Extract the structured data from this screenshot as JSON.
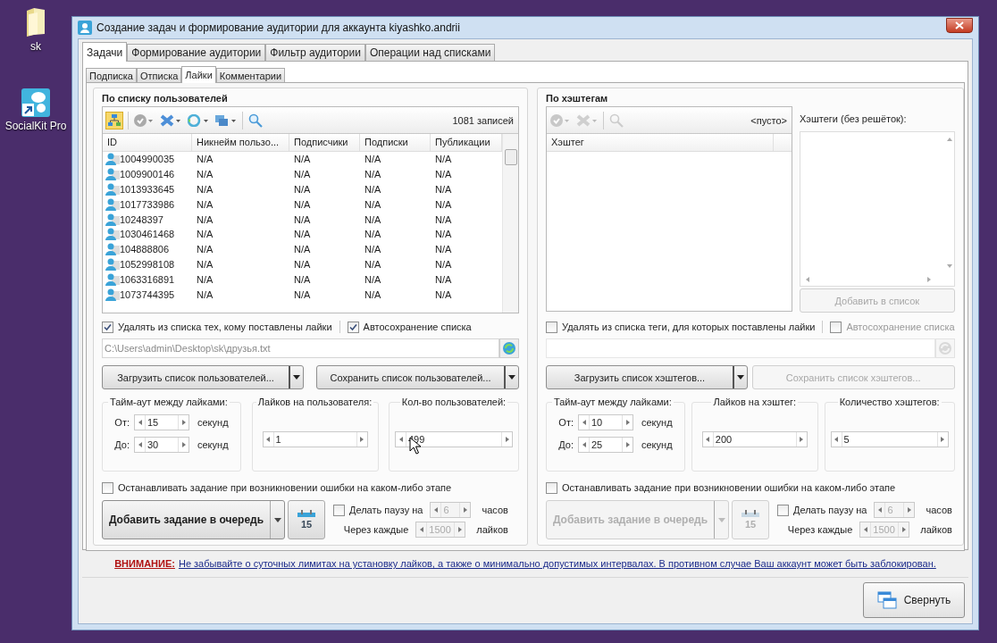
{
  "desktop_icons": [
    {
      "label": "sk",
      "kind": "folder"
    },
    {
      "label": "SocialKit Pro",
      "kind": "app"
    }
  ],
  "window": {
    "title": "Создание задач и формирование аудитории для аккаунта kiyashko.andrii"
  },
  "tabs": [
    {
      "label": "Задачи",
      "selected": true
    },
    {
      "label": "Формирование аудитории",
      "selected": false
    },
    {
      "label": "Фильтр аудитории",
      "selected": false
    },
    {
      "label": "Операции над списками",
      "selected": false
    }
  ],
  "subtabs": [
    {
      "label": "Подписка",
      "selected": false
    },
    {
      "label": "Отписка",
      "selected": false
    },
    {
      "label": "Лайки",
      "selected": true
    },
    {
      "label": "Комментарии",
      "selected": false
    }
  ],
  "users_panel": {
    "title": "По списку пользователей",
    "record_count": "1081 записей",
    "table": {
      "columns": [
        "ID",
        "Никнейм пользо...",
        "Подписчики",
        "Подписки",
        "Публикации"
      ],
      "rows": [
        [
          "1004990035",
          "N/A",
          "N/A",
          "N/A",
          "N/A"
        ],
        [
          "1009900146",
          "N/A",
          "N/A",
          "N/A",
          "N/A"
        ],
        [
          "1013933645",
          "N/A",
          "N/A",
          "N/A",
          "N/A"
        ],
        [
          "1017733986",
          "N/A",
          "N/A",
          "N/A",
          "N/A"
        ],
        [
          "10248397",
          "N/A",
          "N/A",
          "N/A",
          "N/A"
        ],
        [
          "1030461468",
          "N/A",
          "N/A",
          "N/A",
          "N/A"
        ],
        [
          "104888806",
          "N/A",
          "N/A",
          "N/A",
          "N/A"
        ],
        [
          "1052998108",
          "N/A",
          "N/A",
          "N/A",
          "N/A"
        ],
        [
          "1063316891",
          "N/A",
          "N/A",
          "N/A",
          "N/A"
        ],
        [
          "1073744395",
          "N/A",
          "N/A",
          "N/A",
          "N/A"
        ]
      ]
    },
    "remove_checkbox": {
      "label": "Удалять из списка тех, кому поставлены лайки",
      "checked": true
    },
    "autosave_checkbox": {
      "label": "Автосохранение списка",
      "checked": true,
      "disabled": false
    },
    "path_field": {
      "value": "C:\\Users\\admin\\Desktop\\sk\\друзья.txt",
      "disabled": false
    },
    "load_button": {
      "label": "Загрузить список пользователей...",
      "kind": "split",
      "disabled": false
    },
    "save_button": {
      "label": "Сохранить список пользователей...",
      "kind": "split",
      "disabled": false
    },
    "timeout": {
      "title": "Тайм-аут между лайками:",
      "from_label": "От:",
      "from": {
        "value": "15",
        "disabled": false
      },
      "from_unit": "секунд",
      "to_label": "До:",
      "to": {
        "value": "30",
        "disabled": false
      },
      "to_unit": "секунд"
    },
    "per_item": {
      "title": "Лайков на пользователя:",
      "field": {
        "value": "1",
        "disabled": false
      }
    },
    "count": {
      "title": "Кол-во пользователей:",
      "field": {
        "value": "499",
        "disabled": false
      }
    },
    "stop_checkbox": {
      "label": "Останавливать задание при возникновении ошибки на каком-либо этапе",
      "checked": false
    },
    "add_button": {
      "label": "Добавить задание в очередь",
      "disabled": false
    },
    "calendar_button": {
      "day": "15",
      "disabled": false
    },
    "pause": {
      "label": "Делать паузу на",
      "checked": false,
      "hours": {
        "value": "6",
        "disabled": true
      },
      "hours_unit": "часов",
      "every_label": "Через каждые",
      "every": {
        "value": "1500",
        "disabled": true
      },
      "every_unit": "лайков"
    }
  },
  "hashtags_panel": {
    "title": "По хэштегам",
    "record_count": "<пусто>",
    "table": {
      "columns": [
        "Хэштег"
      ]
    },
    "hashtags_label": "Хэштеги (без решёток):",
    "add_to_list_button": {
      "label": "Добавить в список",
      "disabled": true
    },
    "remove_checkbox": {
      "label": "Удалять из списка теги, для которых поставлены лайки",
      "checked": false
    },
    "autosave_checkbox": {
      "label": "Автосохранение списка",
      "checked": false,
      "disabled": true
    },
    "path_field": {
      "disabled": true
    },
    "load_button": {
      "label": "Загрузить список хэштегов...",
      "kind": "split",
      "disabled": false
    },
    "save_button": {
      "label": "Сохранить список хэштегов...",
      "kind": "plain",
      "disabled": true
    },
    "timeout": {
      "title": "Тайм-аут между лайками:",
      "from_label": "От:",
      "from": {
        "value": "10",
        "disabled": false
      },
      "from_unit": "секунд",
      "to_label": "До:",
      "to": {
        "value": "25",
        "disabled": false
      },
      "to_unit": "секунд"
    },
    "per_item": {
      "title": "Лайков на хэштег:",
      "field": {
        "value": "200",
        "disabled": false
      }
    },
    "count": {
      "title": "Количество хэштегов:",
      "field": {
        "value": "5",
        "disabled": false
      }
    },
    "stop_checkbox": {
      "label": "Останавливать задание при возникновении ошибки на каком-либо этапе",
      "checked": false
    },
    "add_button": {
      "label": "Добавить задание в очередь",
      "disabled": true
    },
    "calendar_button": {
      "day": "15",
      "disabled": true
    },
    "pause": {
      "label": "Делать паузу на",
      "checked": false,
      "hours": {
        "value": "6",
        "disabled": true
      },
      "hours_unit": "часов",
      "every_label": "Через каждые",
      "every": {
        "value": "1500",
        "disabled": true
      },
      "every_unit": "лайков"
    }
  },
  "warning": {
    "label": "ВНИМАНИЕ:",
    "text": "Не забывайте о суточных лимитах на установку лайков, а также о минимально допустимых интервалах. В противном случае Ваш аккаунт может быть заблокирован."
  },
  "collapse_button": {
    "label": "Свернуть"
  }
}
